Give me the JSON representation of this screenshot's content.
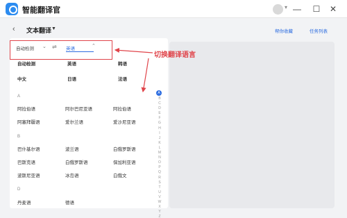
{
  "window": {
    "app_title": "智能翻译官",
    "min_glyph": "—",
    "max_glyph": "☐",
    "close_glyph": "✕"
  },
  "header": {
    "back_glyph": "‹",
    "page_title": "文本翻译",
    "caret_glyph": "▼",
    "help_link": "帮你收藏",
    "tasks_link": "任务列表"
  },
  "lang_bar": {
    "source": "自动检测",
    "target": "英语",
    "source_caret": "⌄",
    "target_caret": "⌃",
    "swap_glyph": "⇌"
  },
  "annotation": "切换翻译语言",
  "common_langs": [
    [
      "自动检测",
      "英语",
      "韩语"
    ],
    [
      "中文",
      "日语",
      "法语"
    ]
  ],
  "groups": [
    {
      "letter": "A",
      "rows": [
        [
          "阿拉伯语",
          "阿尔巴尼亚语",
          "阿拉伯语"
        ],
        [
          "阿塞拜疆语",
          "爱尔兰语",
          "爱沙尼亚语"
        ]
      ]
    },
    {
      "letter": "B",
      "rows": [
        [
          "巴什基尔语",
          "波兰语",
          "白俄罗斯语"
        ],
        [
          "巴斯克语",
          "白俄罗斯语",
          "保加利亚语"
        ],
        [
          "波斯尼亚语",
          "冰岛语",
          "白俄文"
        ]
      ]
    },
    {
      "letter": "D",
      "rows": [
        [
          "丹麦语",
          "德语"
        ]
      ]
    }
  ],
  "alphabet": {
    "top": "A",
    "letters": [
      "B",
      "C",
      "D",
      "E",
      "F",
      "G",
      "H",
      "I",
      "J",
      "K",
      "L",
      "M",
      "N",
      "O",
      "P",
      "Q",
      "R",
      "S",
      "T",
      "U",
      "V",
      "W",
      "X",
      "Y",
      "Z"
    ]
  },
  "colors": {
    "accent": "#2d6de0",
    "annotation": "#e0444a"
  }
}
